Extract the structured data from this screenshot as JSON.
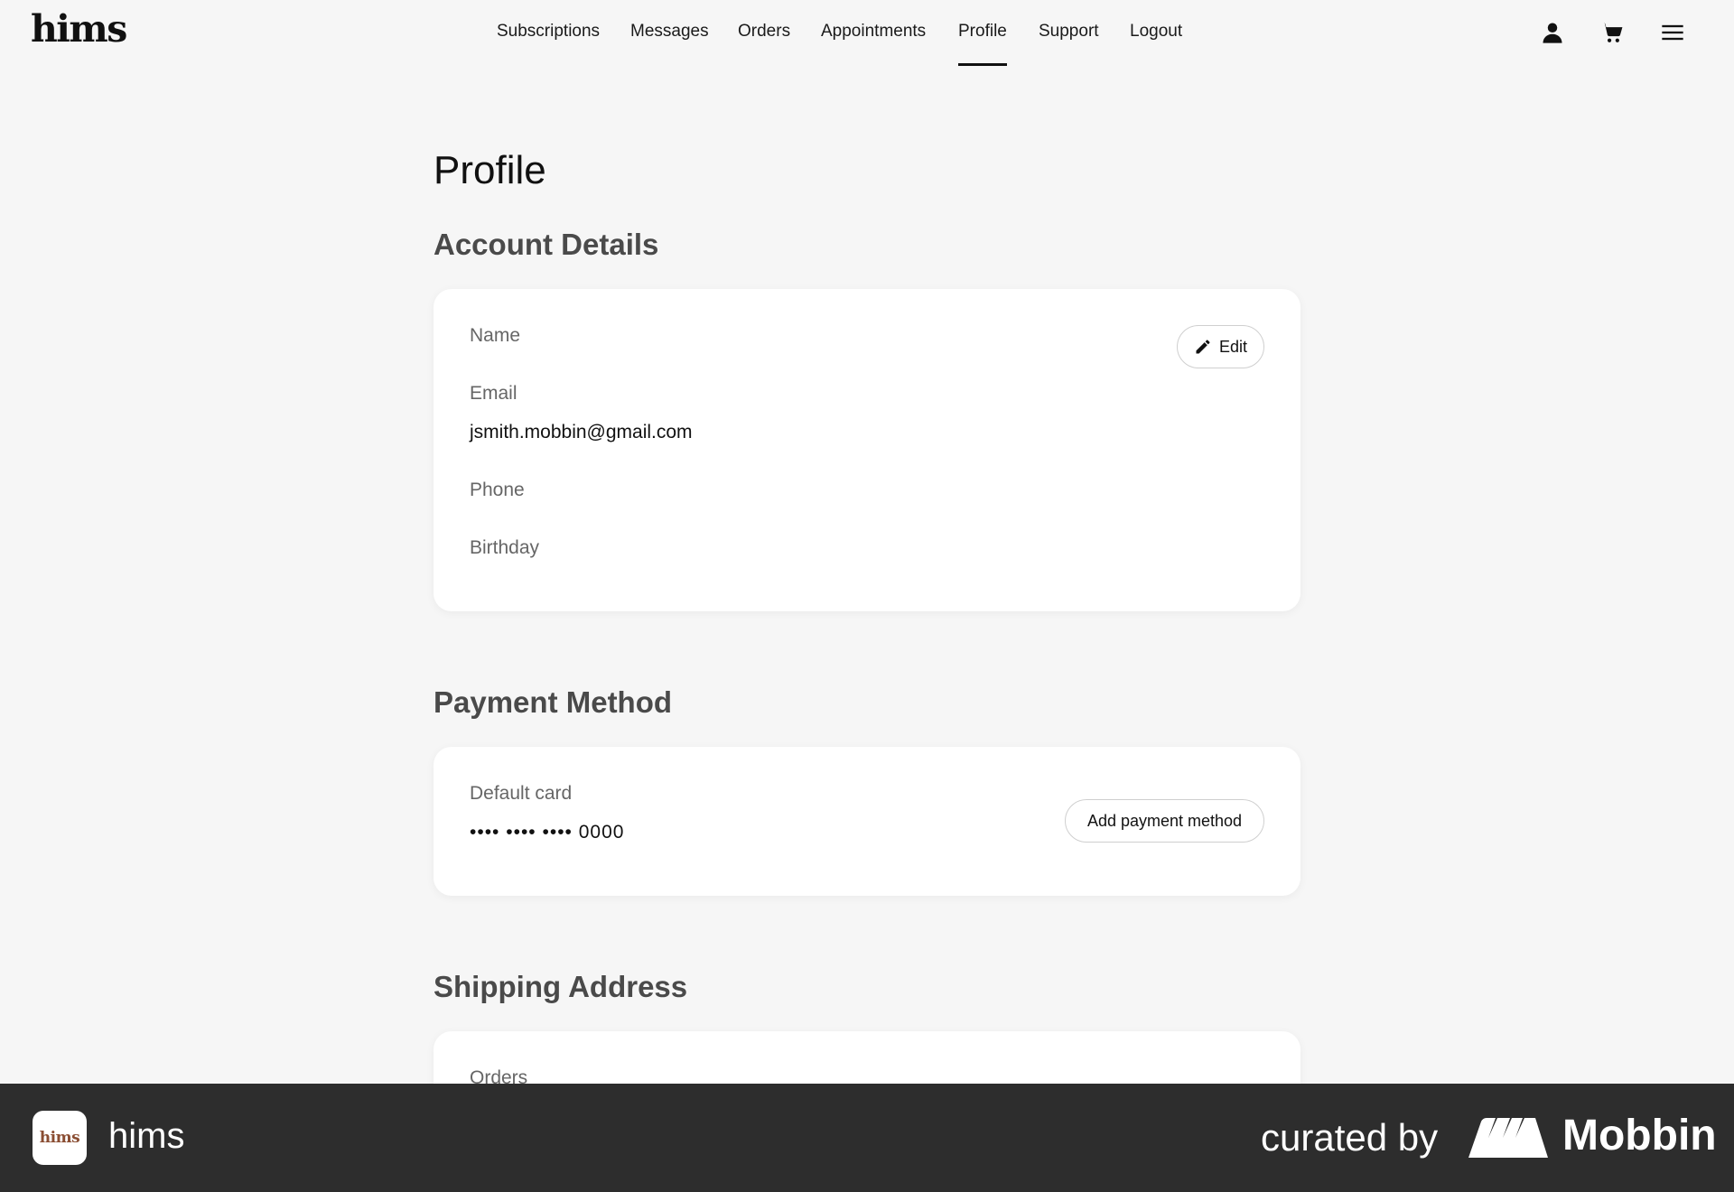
{
  "brand": {
    "logo": "hims"
  },
  "nav": {
    "items": [
      {
        "label": "Subscriptions",
        "active": false
      },
      {
        "label": "Messages",
        "active": false
      },
      {
        "label": "Orders",
        "active": false
      },
      {
        "label": "Appointments",
        "active": false
      },
      {
        "label": "Profile",
        "active": true
      },
      {
        "label": "Support",
        "active": false
      },
      {
        "label": "Logout",
        "active": false
      }
    ],
    "icons": [
      "account-icon",
      "cart-icon",
      "menu-icon"
    ]
  },
  "page": {
    "title": "Profile"
  },
  "account": {
    "heading": "Account Details",
    "name_label": "Name",
    "name_value": "",
    "email_label": "Email",
    "email_value": "jsmith.mobbin@gmail.com",
    "phone_label": "Phone",
    "phone_value": "",
    "birthday_label": "Birthday",
    "birthday_value": "",
    "edit_label": "Edit"
  },
  "payment": {
    "heading": "Payment Method",
    "card_label": "Default card",
    "card_value": "•••• •••• •••• 0000",
    "add_label": "Add payment method"
  },
  "shipping": {
    "heading": "Shipping Address",
    "first_label": "Orders"
  },
  "footer": {
    "app_icon_text": "hims",
    "app_name": "hims",
    "curated_by": "curated by",
    "curator": "Mobbin"
  },
  "colors": {
    "background": "#f6f6f6",
    "card": "#ffffff",
    "text": "#1a1a1a",
    "muted": "#666666",
    "footer": "#2d2d2d",
    "accent": "#111111"
  }
}
